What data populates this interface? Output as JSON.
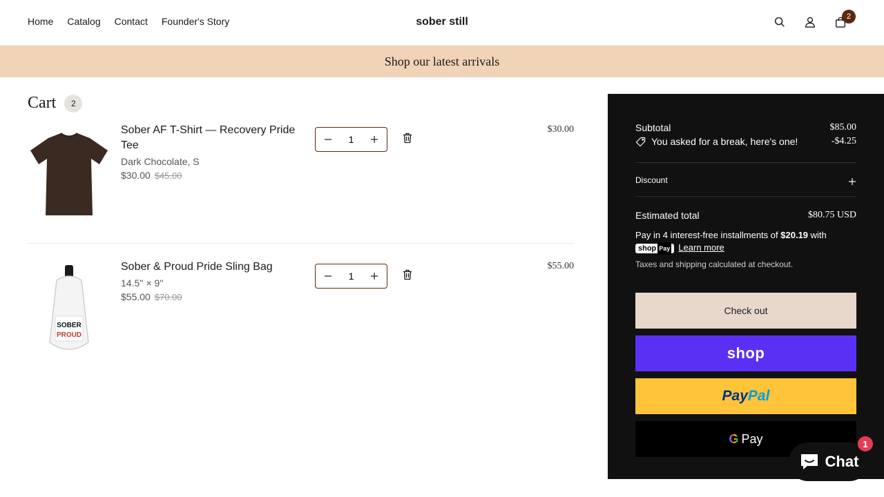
{
  "header": {
    "nav": [
      "Home",
      "Catalog",
      "Contact",
      "Founder's Story"
    ],
    "brand": "sober still",
    "cart_count": "2",
    "icons": [
      "search-icon",
      "account-icon",
      "bag-icon"
    ]
  },
  "announcement": "Shop our latest arrivals",
  "cart": {
    "title": "Cart",
    "count": "2",
    "items": [
      {
        "name": "Sober AF T-Shirt — Recovery Pride Tee",
        "variant": "Dark Chocolate,  S",
        "price": "$30.00",
        "compare_price": "$45.00",
        "quantity": "1",
        "line_total": "$30.00"
      },
      {
        "name": "Sober & Proud Pride Sling Bag",
        "variant": "14.5'' × 9''",
        "price": "$55.00",
        "compare_price": "$70.00",
        "quantity": "1",
        "line_total": "$55.00"
      }
    ]
  },
  "summary": {
    "subtotal_label": "Subtotal",
    "subtotal_value": "$85.00",
    "discount_text": "You asked for a break, here's one!",
    "discount_value": "-$4.25",
    "discount_label": "Discount",
    "estimated_label": "Estimated total",
    "estimated_value": "$80.75 USD",
    "installments_pre": "Pay in 4 interest-free installments of ",
    "installments_amount": "$20.19",
    "installments_post": " with",
    "shoppay_badge": "shop",
    "shoppay_badge_pay": "Pay",
    "learn_more": "Learn more",
    "taxes": "Taxes and shipping calculated at checkout.",
    "checkout": "Check out",
    "shop_button": "shop",
    "paypal_part1": "Pay",
    "paypal_part2": "Pal",
    "gpay_g": "G",
    "gpay_text": "Pay"
  },
  "chat": {
    "label": "Chat",
    "badge": "1"
  },
  "colors": {
    "accent_brown": "#5a2a0e",
    "announcement_bg": "#f1d3b8",
    "summary_bg": "#111111",
    "shop_pay": "#5a31f4",
    "paypal": "#ffc439"
  }
}
